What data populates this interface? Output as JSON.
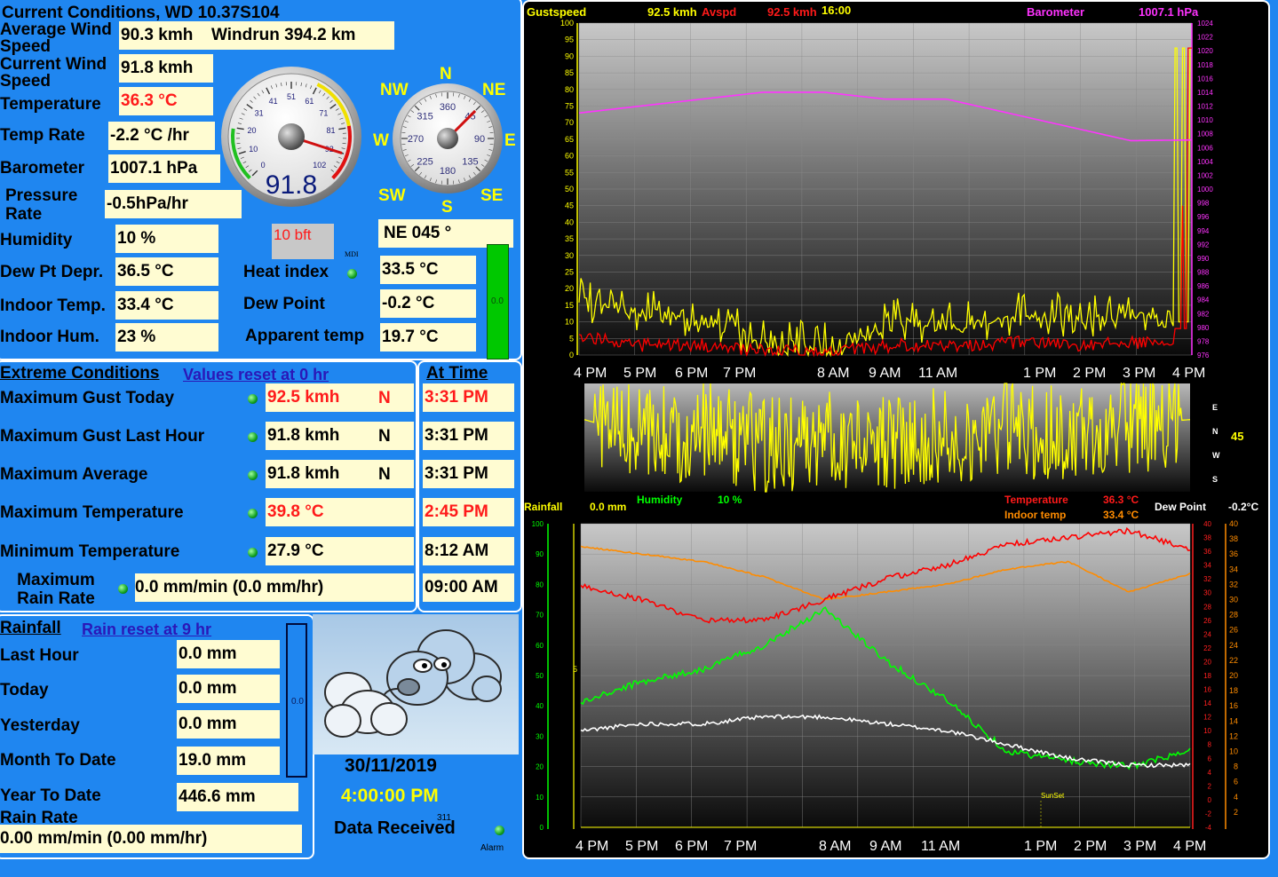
{
  "current": {
    "title": "Current Conditions, WD 10.37S104",
    "avg_wind_label": "Average Wind Speed",
    "avg_wind_value": "90.3 kmh",
    "windrun": "Windrun 394.2 km",
    "cur_wind_label": "Current Wind Speed",
    "cur_wind_value": "91.8 kmh",
    "temp_label": "Temperature",
    "temp_value": "36.3 °C",
    "temp_rate_label": "Temp Rate",
    "temp_rate_value": "-2.2 °C /hr",
    "baro_label": "Barometer",
    "baro_value": "1007.1 hPa",
    "pressure_rate_label": "Pressure Rate",
    "pressure_rate_value": "-0.5hPa/hr",
    "humidity_label": "Humidity",
    "humidity_value": "10 %",
    "dewdepr_label": "Dew Pt Depr.",
    "dewdepr_value": "36.5 °C",
    "indoor_temp_label": "Indoor Temp.",
    "indoor_temp_value": "33.4 °C",
    "indoor_hum_label": "Indoor Hum.",
    "indoor_hum_value": "23 %",
    "heat_index_label": "Heat index",
    "heat_index_value": "33.5 °C",
    "dew_point_label": "Dew Point",
    "dew_point_value": "-0.2 °C",
    "apparent_label": "Apparent temp",
    "apparent_value": "19.7 °C",
    "bft": "10 bft",
    "mdi": "MDI",
    "wind_dir": "NE  045 °",
    "bar_value": "0.0"
  },
  "speed_gauge": {
    "value": 91.8,
    "readout": "91.8",
    "ticks": [
      "0",
      "10",
      "20",
      "31",
      "41",
      "51",
      "61",
      "71",
      "81",
      "92",
      "102"
    ]
  },
  "compass": {
    "direction_deg": 45,
    "degree_labels": [
      "360",
      "45",
      "90",
      "135",
      "180",
      "225",
      "270",
      "315"
    ],
    "n": "N",
    "ne": "NE",
    "e": "E",
    "se": "SE",
    "s": "S",
    "sw": "SW",
    "w": "W",
    "nw": "NW"
  },
  "extreme": {
    "title": "Extreme Conditions",
    "reset": "Values reset at 0 hr",
    "at_time": "At Time",
    "rows": [
      {
        "label": "Maximum Gust Today",
        "value": "92.5 kmh",
        "dir": "N",
        "time": "3:31 PM",
        "red": true
      },
      {
        "label": "Maximum Gust Last Hour",
        "value": "91.8 kmh",
        "dir": "N",
        "time": "3:31 PM",
        "red": false
      },
      {
        "label": "Maximum Average",
        "value": "91.8 kmh",
        "dir": "N",
        "time": "3:31 PM",
        "red": false
      },
      {
        "label": "Maximum Temperature",
        "value": "39.8 °C",
        "dir": "",
        "time": "2:45 PM",
        "red": true
      },
      {
        "label": "Minimum Temperature",
        "value": "27.9 °C",
        "dir": "",
        "time": "8:12 AM",
        "red": false
      }
    ],
    "max_rain_label": "Maximum Rain Rate",
    "max_rain_value": "0.0 mm/min (0.0 mm/hr)",
    "max_rain_time": "09:00 AM"
  },
  "rain": {
    "title": "Rainfall",
    "reset": "Rain reset at 9 hr",
    "last_hour_label": "Last Hour",
    "last_hour": "0.0 mm",
    "today_label": "Today",
    "today": "0.0 mm",
    "yesterday_label": "Yesterday",
    "yesterday": "0.0 mm",
    "month_label": "Month To Date",
    "month": "19.0 mm",
    "year_label": "Year To Date",
    "year": "446.6 mm",
    "rate_label": "Rain Rate",
    "rate": "0.00 mm/min (0.00 mm/hr)",
    "bar_value": "0.0"
  },
  "status": {
    "date": "30/11/2019",
    "time": "4:00:00 PM",
    "data_received": "Data Received",
    "counter": "311",
    "alarm": "Alarm"
  },
  "colors": {
    "background": "#1f86f0",
    "value_box": "#fffcd2",
    "gust": "#ffff00",
    "avg": "#ff0000",
    "barometer": "#ff33ff",
    "temperature": "#ff0000",
    "indoor": "#ff8c00",
    "humidity": "#00ff00",
    "dewpoint": "#ffffff"
  },
  "chart_data": [
    {
      "type": "line",
      "legend": {
        "gust_label": "Gustspeed",
        "gust_value": "92.5 kmh",
        "avg_label": "Avspd",
        "avg_value": "92.5 kmh",
        "clock": "16:00",
        "baro_label": "Barometer",
        "baro_value": "1007.1 hPa"
      },
      "x": [
        "4 PM",
        "5 PM",
        "6 PM",
        "7 PM",
        "8 AM",
        "9 AM",
        "11 AM",
        "1 PM",
        "2 PM",
        "3 PM",
        "4 PM"
      ],
      "ylim": [
        0,
        100
      ],
      "y_ticks": [
        0,
        5,
        10,
        15,
        20,
        25,
        30,
        35,
        40,
        45,
        50,
        55,
        60,
        65,
        70,
        75,
        80,
        85,
        90,
        95,
        100
      ],
      "y2lim": [
        976,
        1024
      ],
      "y2_ticks": [
        976,
        978,
        980,
        982,
        984,
        986,
        988,
        990,
        992,
        994,
        996,
        998,
        1000,
        1002,
        1004,
        1006,
        1008,
        1010,
        1012,
        1014,
        1016,
        1018,
        1020,
        1022,
        1024
      ],
      "series": [
        {
          "name": "Gustspeed",
          "values": [
            15,
            12,
            10,
            2,
            2,
            10,
            8,
            12,
            10,
            12,
            92.5
          ]
        },
        {
          "name": "Avspd",
          "values": [
            6,
            3,
            3,
            1,
            1,
            3,
            3,
            4,
            3,
            4,
            92.5
          ]
        },
        {
          "name": "Barometer",
          "axis": "right",
          "values": [
            1011,
            1012,
            1013,
            1014,
            1014,
            1013,
            1013,
            1011,
            1009,
            1007,
            1007.1
          ]
        }
      ]
    },
    {
      "type": "line",
      "x": [
        "4 PM",
        "5 PM",
        "6 PM",
        "7 PM",
        "8 AM",
        "9 AM",
        "11 AM",
        "1 PM",
        "2 PM",
        "3 PM",
        "4 PM"
      ],
      "side_labels": [
        "E",
        "N",
        "W",
        "S"
      ],
      "current_value": "45",
      "series": [
        {
          "name": "Wind direction",
          "values": [
            80,
            60,
            70,
            50,
            60,
            55,
            65,
            70,
            60,
            75,
            80
          ]
        }
      ]
    },
    {
      "type": "line",
      "legend": {
        "rain_label": "Rainfall",
        "rain_value": "0.0 mm",
        "hum_label": "Humidity",
        "hum_value": "10 %",
        "temp_label": "Temperature",
        "temp_value": "36.3 °C",
        "indoor_label": "Indoor temp",
        "indoor_value": "33.4 °C",
        "dew_label": "Dew Point",
        "dew_value": "-0.2°C"
      },
      "x": [
        "4 PM",
        "5 PM",
        "6 PM",
        "7 PM",
        "8 AM",
        "9 AM",
        "11 AM",
        "1 PM",
        "2 PM",
        "3 PM",
        "4 PM"
      ],
      "ylim": [
        0,
        100
      ],
      "y_ticks": [
        0,
        10,
        20,
        30,
        40,
        50,
        60,
        70,
        80,
        90,
        100
      ],
      "rain_mark": "5",
      "temp_ticks": [
        -4,
        -2,
        0,
        2,
        4,
        6,
        8,
        10,
        12,
        14,
        16,
        18,
        20,
        22,
        24,
        26,
        28,
        30,
        32,
        34,
        36,
        38,
        40
      ],
      "indoor_ticks": [
        2,
        4,
        6,
        8,
        10,
        12,
        14,
        16,
        18,
        20,
        22,
        24,
        26,
        28,
        30,
        32,
        34,
        36,
        38,
        40
      ],
      "annotation": "SunSet",
      "series": [
        {
          "name": "Humidity",
          "values": [
            41,
            48,
            52,
            60,
            72,
            55,
            42,
            25,
            22,
            20,
            25
          ]
        },
        {
          "name": "Temperature",
          "values": [
            31,
            29,
            26,
            26,
            29,
            32,
            34,
            37,
            38,
            39,
            36.3
          ]
        },
        {
          "name": "Indoor temp",
          "values": [
            37,
            36,
            35,
            33,
            30,
            31,
            32,
            34,
            35,
            31,
            33.4
          ]
        },
        {
          "name": "Dew Point",
          "values": [
            10,
            11,
            11,
            12,
            12,
            11,
            10,
            8,
            6,
            5,
            5
          ]
        }
      ]
    }
  ]
}
